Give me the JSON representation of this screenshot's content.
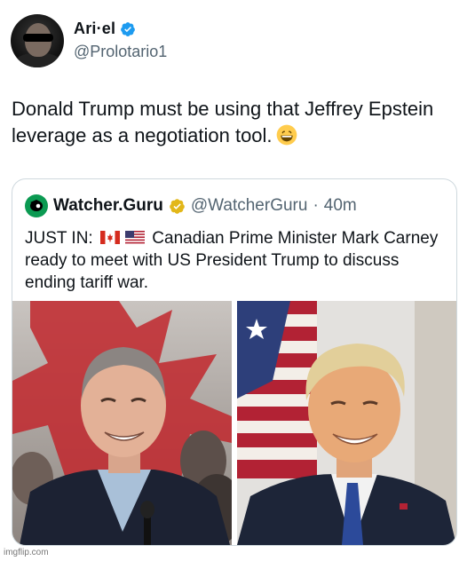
{
  "tweet": {
    "author": {
      "display_name": "Ari·el",
      "handle": "@Prolotario1",
      "verified": true
    },
    "text": "Donald Trump must be using that Jeffrey Epstein leverage as a negotiation tool.",
    "emoji": "grinning-face-with-smiling-eyes"
  },
  "quoted_tweet": {
    "author": {
      "display_name": "Watcher.Guru",
      "handle": "@WatcherGuru",
      "time": "40m",
      "verified_badge": "gold"
    },
    "text_prefix": "JUST IN:",
    "flags": [
      "canada-flag",
      "us-flag"
    ],
    "text": "Canadian Prime Minister Mark Carney ready to meet with US President Trump to discuss ending tariff war.",
    "images": [
      "mark-carney-photo",
      "donald-trump-photo"
    ]
  },
  "watermark": "imgflip.com",
  "colors": {
    "text_primary": "#0f1419",
    "text_secondary": "#536471",
    "verified_blue": "#1d9bf0",
    "verified_gold": "#e2b719",
    "border": "#cfd9de",
    "brand_green": "#0b9a52"
  }
}
